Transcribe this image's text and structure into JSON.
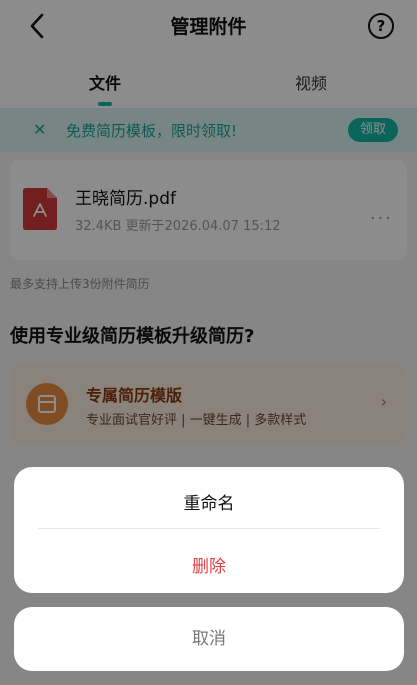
{
  "header": {
    "title": "管理附件"
  },
  "tabs": [
    {
      "label": "文件"
    },
    {
      "label": "视频"
    }
  ],
  "banner": {
    "text": "免费简历模板，限时领取!",
    "button": "领取"
  },
  "file": {
    "name": "王晓简历.pdf",
    "meta": "32.4KB 更新于2026.04.07 15:12",
    "more": "···"
  },
  "limit_note": "最多支持上传3份附件简历",
  "upgrade_title": "使用专业级简历模板升级简历?",
  "template_card": {
    "title": "专属简历模版",
    "subtitle": "专业面试官好评 | 一键生成 | 多款样式"
  },
  "sheet": {
    "rename": "重命名",
    "delete": "删除",
    "cancel": "取消"
  },
  "colors": {
    "accent": "#14b7a8",
    "danger": "#e0404a",
    "template_orange": "#e88a42"
  }
}
